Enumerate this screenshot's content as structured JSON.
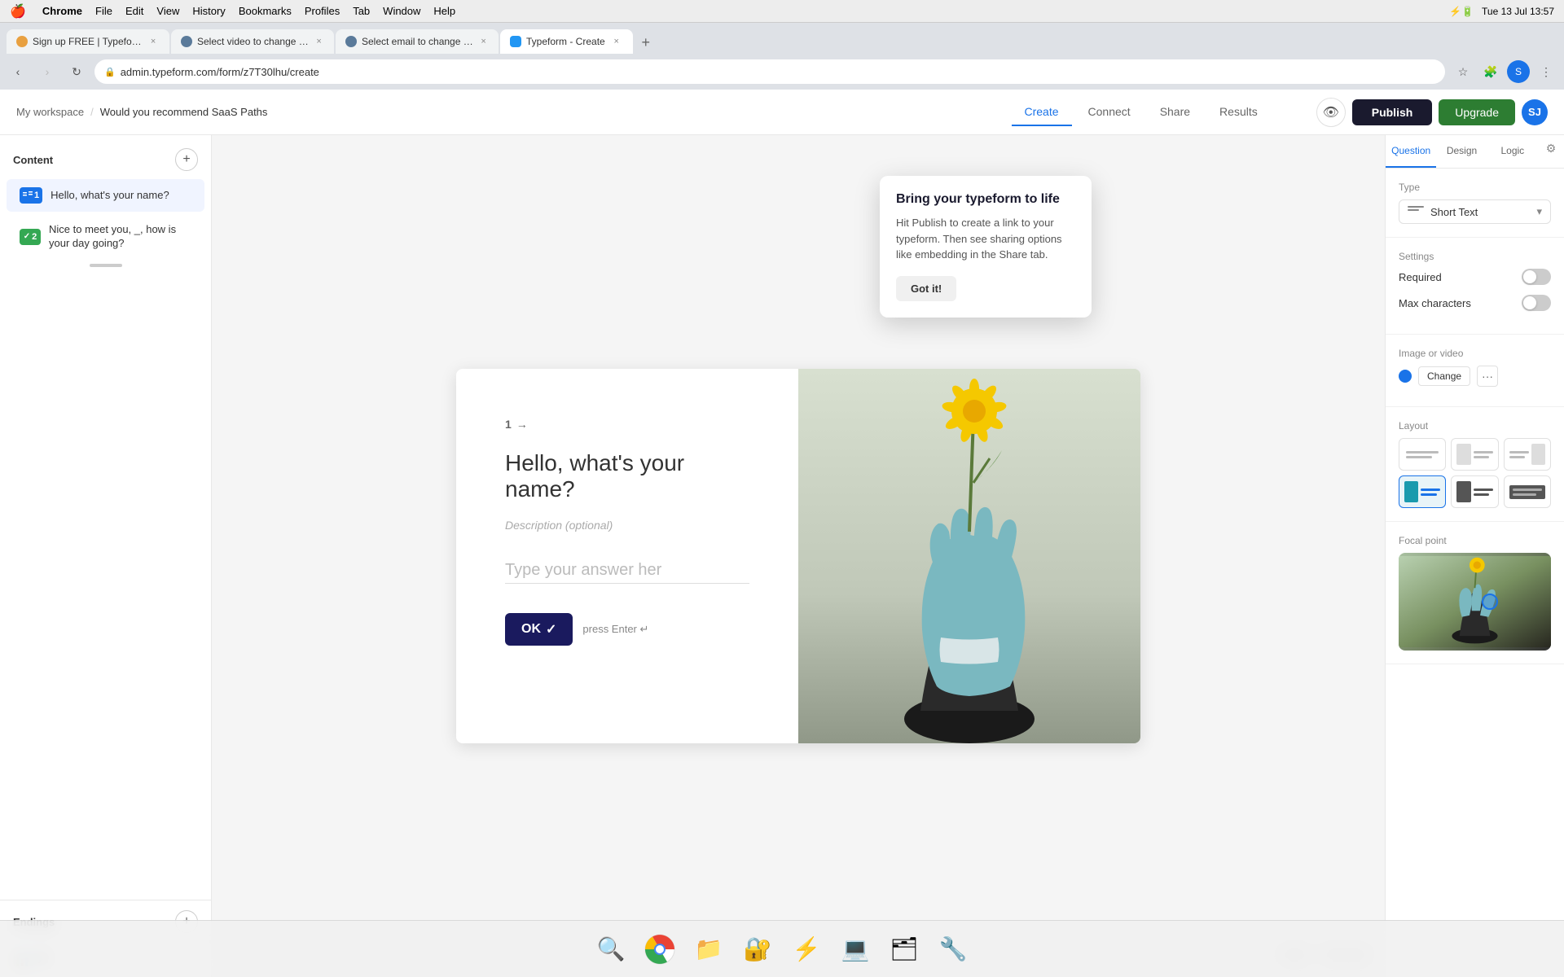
{
  "menubar": {
    "apple": "🍎",
    "items": [
      "Chrome",
      "File",
      "Edit",
      "View",
      "History",
      "Bookmarks",
      "Profiles",
      "Tab",
      "Window",
      "Help"
    ],
    "bold_item": "Chrome",
    "right": {
      "battery": "🔋",
      "time": "Tue 13 Jul  13:57",
      "charge_icon": "⚡"
    }
  },
  "browser": {
    "tabs": [
      {
        "id": "tab1",
        "title": "Sign up FREE | Typeform",
        "active": false,
        "favicon_color": "#e8a040"
      },
      {
        "id": "tab2",
        "title": "Select video to change | Djang...",
        "active": false,
        "favicon_color": "#5a7a9a"
      },
      {
        "id": "tab3",
        "title": "Select email to change | Djang...",
        "active": false,
        "favicon_color": "#5a7a9a"
      },
      {
        "id": "tab4",
        "title": "Typeform - Create",
        "active": true,
        "favicon_color": "#2196f3"
      }
    ],
    "url": "admin.typeform.com/form/z7T30lhu/create"
  },
  "app_header": {
    "workspace": "My workspace",
    "separator": "/",
    "form_title": "Would you recommend SaaS Paths",
    "tabs": [
      "Create",
      "Connect",
      "Share",
      "Results"
    ],
    "active_tab": "Create",
    "publish_label": "Publish",
    "upgrade_label": "Upgrade",
    "user_initials": "SJ"
  },
  "sidebar": {
    "content_label": "Content",
    "add_label": "+",
    "items": [
      {
        "id": 1,
        "number": "1",
        "text": "Hello, what's your name?",
        "badge_color": "#1a73e8"
      },
      {
        "id": 2,
        "number": "2",
        "text": "Nice to meet you, _, how is your day going?",
        "badge_color": "#34a853"
      }
    ],
    "endings_label": "Endings",
    "bottom_icons": [
      "bar-chart",
      "A"
    ]
  },
  "form_preview": {
    "question_number": "1",
    "question_text": "Hello, what's your name?",
    "description_placeholder": "Description (optional)",
    "answer_placeholder": "Type your answer her",
    "ok_label": "OK",
    "check_mark": "✓",
    "press_enter_text": "press Enter ↵"
  },
  "right_panel": {
    "tabs": [
      "Question",
      "Design",
      "Logic"
    ],
    "active_tab": "Question",
    "type_section": {
      "label": "Type",
      "selected": "Short Text"
    },
    "settings": {
      "label": "Settings",
      "required_label": "Required",
      "required_on": false,
      "max_characters_label": "Max characters",
      "max_characters_on": false
    },
    "image_video": {
      "label": "Image or video",
      "change_label": "Change",
      "more_label": "···"
    },
    "layout": {
      "label": "Layout"
    },
    "focal_point": {
      "label": "Focal point"
    },
    "gear_icon": "⚙"
  },
  "tooltip": {
    "title": "Bring your typeform to life",
    "body": "Hit Publish to create a link to your typeform. Then see sharing options like embedding in the Share tab.",
    "button_label": "Got it!"
  },
  "footer": {
    "help_label": "Help?",
    "feedback_label": "Feedback"
  },
  "dock": {
    "items": [
      "🔍",
      "🌐",
      "📁",
      "🔐",
      "⚡",
      "💻",
      "🗂",
      "🔧"
    ]
  }
}
